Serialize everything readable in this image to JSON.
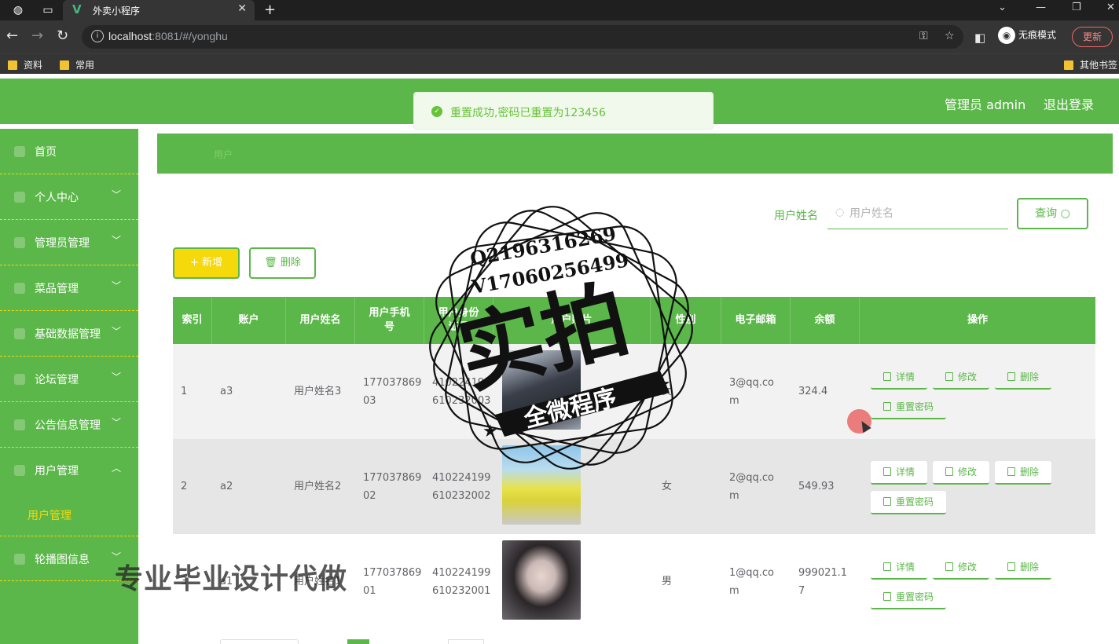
{
  "browser": {
    "tab_title": "外卖小程序",
    "url_host": "localhost",
    "url_rest": ":8081/#/yonghu",
    "incognito_label": "无痕模式",
    "update_label": "更新",
    "bookmarks": [
      "资料",
      "常用"
    ],
    "other_bookmarks": "其他书签"
  },
  "header": {
    "admin_label": "管理员 admin",
    "logout_label": "退出登录"
  },
  "toast": {
    "message": "重置成功,密码已重置为123456"
  },
  "sidebar": {
    "items": [
      {
        "label": "首页",
        "arrow": ""
      },
      {
        "label": "个人中心",
        "arrow": "﹀"
      },
      {
        "label": "管理员管理",
        "arrow": "﹀"
      },
      {
        "label": "菜品管理",
        "arrow": "﹀"
      },
      {
        "label": "基础数据管理",
        "arrow": "﹀"
      },
      {
        "label": "论坛管理",
        "arrow": "﹀"
      },
      {
        "label": "公告信息管理",
        "arrow": "﹀"
      },
      {
        "label": "用户管理",
        "arrow": "︿"
      },
      {
        "label": "轮播图信息",
        "arrow": "﹀"
      }
    ],
    "active_sub": "用户管理"
  },
  "breadcrumb": "用户",
  "search": {
    "label": "用户姓名",
    "placeholder": "用户姓名",
    "button": "查询"
  },
  "actions": {
    "add": "+ 新增",
    "delete": "删除"
  },
  "table": {
    "headers": [
      "索引",
      "账户",
      "用户姓名",
      "用户手机号",
      "用户身份证号",
      "用户照片",
      "性别",
      "电子邮箱",
      "余额",
      "操作"
    ],
    "rows": [
      {
        "index": "1",
        "account": "a3",
        "name": "用户姓名3",
        "phone": "17703786903",
        "idcard": "410224199610232003",
        "gender": "女",
        "email": "3@qq.com",
        "balance": "324.4"
      },
      {
        "index": "2",
        "account": "a2",
        "name": "用户姓名2",
        "phone": "17703786902",
        "idcard": "410224199610232002",
        "gender": "女",
        "email": "2@qq.com",
        "balance": "549.93"
      },
      {
        "index": "3",
        "account": "a1",
        "name": "用户姓名1",
        "phone": "17703786901",
        "idcard": "410224199610232001",
        "gender": "男",
        "email": "1@qq.com",
        "balance": "999021.17"
      }
    ],
    "ops": {
      "detail": "详情",
      "edit": "修改",
      "delete": "删除",
      "reset": "重置密码"
    }
  },
  "watermark": {
    "q": "Q2196316269",
    "v": "V17060256499",
    "big": "实拍",
    "banner": "全微程序",
    "bottom": "专业毕业设计代做"
  },
  "colors": {
    "brand_green": "#5cb74a",
    "accent_yellow": "#f5d90a"
  }
}
